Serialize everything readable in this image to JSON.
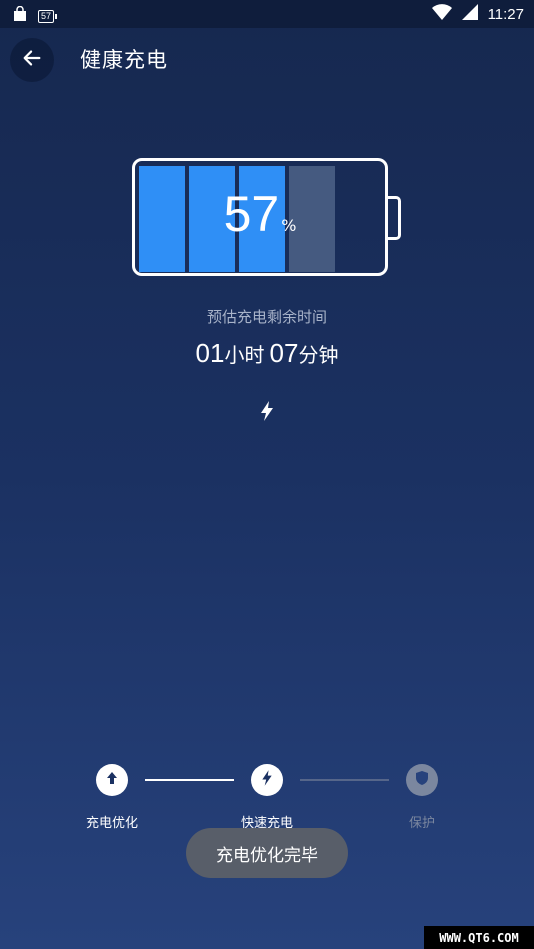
{
  "status_bar": {
    "battery_badge": "57",
    "time": "11:27",
    "icons": [
      "bag-icon",
      "battery-icon",
      "wifi-icon",
      "signal-icon"
    ]
  },
  "header": {
    "title": "健康充电",
    "back_icon": "arrow-left-icon"
  },
  "battery": {
    "percent": "57",
    "percent_unit": "%",
    "fill_fraction": 0.57,
    "cell_color": "#2f8ff6",
    "empty_cell_color": "#455a80"
  },
  "remaining": {
    "label": "预估充电剩余时间",
    "hours": "01",
    "hours_unit": "小时",
    "minutes": "07",
    "minutes_unit": "分钟"
  },
  "steps": [
    {
      "label": "充电优化",
      "icon": "arrow-up-icon",
      "active": true
    },
    {
      "label": "快速充电",
      "icon": "bolt-icon",
      "active": true
    },
    {
      "label": "保护",
      "icon": "shield-icon",
      "active": false
    }
  ],
  "toast": {
    "text": "充电优化完毕"
  },
  "watermark": {
    "text": "WWW.QT6.COM"
  }
}
